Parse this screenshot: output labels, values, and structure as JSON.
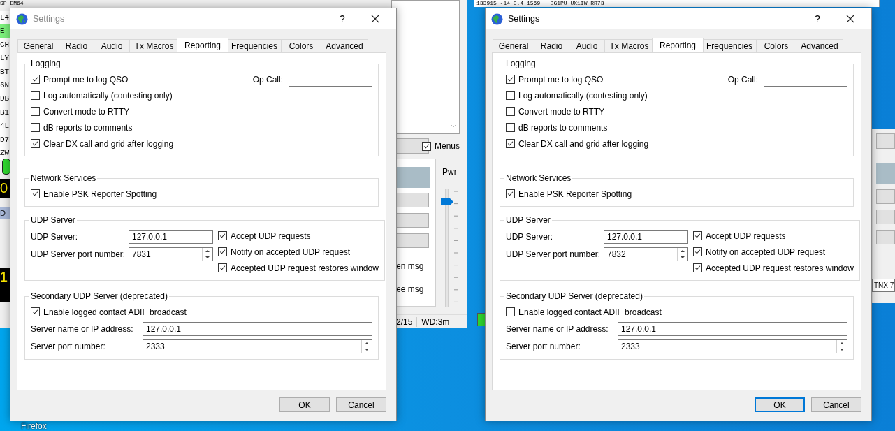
{
  "desktop": {
    "icon_label": "Firefox"
  },
  "background_left": {
    "top_line": "SP EM64",
    "list": [
      {
        "text": "L4",
        "highlighted": false
      },
      {
        "text": "E",
        "highlighted": true
      },
      {
        "text": "CH",
        "highlighted": false
      },
      {
        "text": "LY",
        "highlighted": false
      },
      {
        "text": "BT",
        "highlighted": false
      },
      {
        "text": "6N",
        "highlighted": false
      },
      {
        "text": "DB",
        "highlighted": false
      },
      {
        "text": "B1",
        "highlighted": false
      },
      {
        "text": "4L",
        "highlighted": false
      },
      {
        "text": "D7",
        "highlighted": false
      },
      {
        "text": "ZW",
        "highlighted": false
      }
    ],
    "readout_1": "0",
    "dx_label": "D",
    "readout_2": "1",
    "menus": {
      "label": "Menus",
      "checked": true
    },
    "power": {
      "label": "Pwr",
      "level": 0.88
    },
    "messages": [
      "en msg",
      "ee msg"
    ],
    "status": [
      "2/15",
      "WD:3m"
    ]
  },
  "background_right": {
    "top_line": "133915 -14  0.4 1569 ~  DG1PU UX1IW RR73",
    "field_value": "TNX 7"
  },
  "dialogs": [
    {
      "title": "Settings",
      "active": false,
      "help": "?",
      "tabs": [
        {
          "label": "General",
          "selected": false
        },
        {
          "label": "Radio",
          "selected": false
        },
        {
          "label": "Audio",
          "selected": false
        },
        {
          "label": "Tx Macros",
          "selected": false
        },
        {
          "label": "Reporting",
          "selected": true
        },
        {
          "label": "Frequencies",
          "selected": false
        },
        {
          "label": "Colors",
          "selected": false
        },
        {
          "label": "Advanced",
          "selected": false
        }
      ],
      "logging": {
        "title": "Logging",
        "op_call_label": "Op Call:",
        "options": [
          {
            "label": "Prompt me to log QSO",
            "checked": true
          },
          {
            "label": "Log automatically (contesting only)",
            "checked": false
          },
          {
            "label": "Convert mode to RTTY",
            "checked": false
          },
          {
            "label": "dB reports to comments",
            "checked": false
          },
          {
            "label": "Clear DX call and grid after logging",
            "checked": true
          }
        ]
      },
      "network": {
        "title": "Network Services",
        "options": [
          {
            "label": "Enable PSK Reporter Spotting",
            "checked": true
          }
        ]
      },
      "udp": {
        "title": "UDP Server",
        "server": {
          "label": "UDP Server:",
          "value": "127.0.0.1"
        },
        "port": {
          "label": "UDP Server port number:",
          "value": "7831"
        },
        "options": [
          {
            "label": "Accept UDP requests",
            "checked": true
          },
          {
            "label": "Notify on accepted UDP request",
            "checked": true
          },
          {
            "label": "Accepted UDP request restores window",
            "checked": true
          }
        ]
      },
      "secondary": {
        "title": "Secondary UDP Server (deprecated)",
        "options": [
          {
            "label": "Enable logged contact ADIF broadcast",
            "checked": true
          }
        ],
        "server": {
          "label": "Server name or IP address:",
          "value": "127.0.0.1"
        },
        "port": {
          "label": "Server port number:",
          "value": "2333"
        }
      },
      "buttons": [
        {
          "label": "OK",
          "focused": false
        },
        {
          "label": "Cancel",
          "focused": false
        }
      ]
    },
    {
      "title": "Settings",
      "active": true,
      "help": "?",
      "tabs": [
        {
          "label": "General",
          "selected": false
        },
        {
          "label": "Radio",
          "selected": false
        },
        {
          "label": "Audio",
          "selected": false
        },
        {
          "label": "Tx Macros",
          "selected": false
        },
        {
          "label": "Reporting",
          "selected": true
        },
        {
          "label": "Frequencies",
          "selected": false
        },
        {
          "label": "Colors",
          "selected": false
        },
        {
          "label": "Advanced",
          "selected": false
        }
      ],
      "logging": {
        "title": "Logging",
        "op_call_label": "Op Call:",
        "options": [
          {
            "label": "Prompt me to log QSO",
            "checked": true
          },
          {
            "label": "Log automatically (contesting only)",
            "checked": false
          },
          {
            "label": "Convert mode to RTTY",
            "checked": false
          },
          {
            "label": "dB reports to comments",
            "checked": false
          },
          {
            "label": "Clear DX call and grid after logging",
            "checked": true
          }
        ]
      },
      "network": {
        "title": "Network Services",
        "options": [
          {
            "label": "Enable PSK Reporter Spotting",
            "checked": true
          }
        ]
      },
      "udp": {
        "title": "UDP Server",
        "server": {
          "label": "UDP Server:",
          "value": "127.0.0.1"
        },
        "port": {
          "label": "UDP Server port number:",
          "value": "7832"
        },
        "options": [
          {
            "label": "Accept UDP requests",
            "checked": true
          },
          {
            "label": "Notify on accepted UDP request",
            "checked": true
          },
          {
            "label": "Accepted UDP request restores window",
            "checked": true
          }
        ]
      },
      "secondary": {
        "title": "Secondary UDP Server (deprecated)",
        "options": [
          {
            "label": "Enable logged contact ADIF broadcast",
            "checked": false
          }
        ],
        "server": {
          "label": "Server name or IP address:",
          "value": "127.0.0.1"
        },
        "port": {
          "label": "Server port number:",
          "value": "2333"
        }
      },
      "buttons": [
        {
          "label": "OK",
          "focused": true
        },
        {
          "label": "Cancel",
          "focused": false
        }
      ]
    }
  ]
}
